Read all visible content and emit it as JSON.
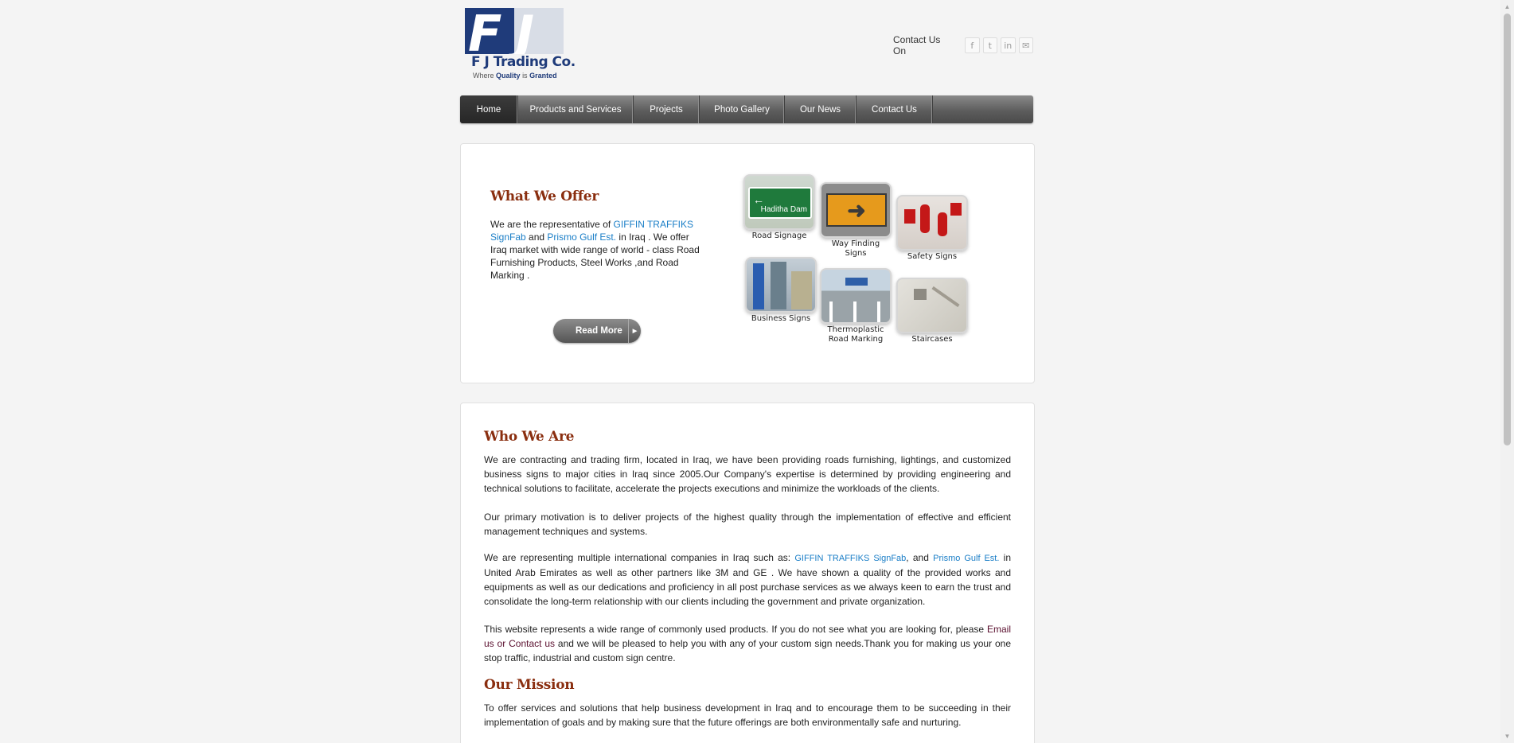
{
  "brand": {
    "name": "F J Trading Co.",
    "tagline_pre": "Where",
    "tagline_q": "Quality",
    "tagline_mid": "is",
    "tagline_g": "Granted",
    "color": "#1f3b7a"
  },
  "header": {
    "contact_label": "Contact Us On",
    "social": [
      "f",
      "t",
      "in",
      "✉"
    ]
  },
  "nav": {
    "items": [
      "Home",
      "Products and Services",
      "Projects",
      "Photo Gallery",
      "Our News",
      "Contact Us"
    ],
    "active": "Home"
  },
  "offer": {
    "title": "What We Offer",
    "text_1": "We are the representative of ",
    "link_giffin": "GIFFIN TRAFFIKS SignFab",
    "text_2": " and ",
    "link_prismo": "Prismo Gulf Est.",
    "text_3": " in Iraq . We offer Iraq market with wide range of world - class Road Furnishing Products, Steel Works ,and Road Marking .",
    "read_more": "Read More",
    "products": [
      "Road Signage",
      "Way Finding Signs",
      "Safety Signs",
      "Business Signs",
      "Thermoplastic Road Marking",
      "Staircases"
    ],
    "sign_text": "Haditha Dam"
  },
  "who": {
    "title": "Who We Are",
    "p1": "We are contracting and trading firm, located in Iraq, we have been providing roads furnishing, lightings, and customized business signs to major cities in Iraq since 2005.Our Company's expertise is determined by providing engineering and technical solutions to facilitate, accelerate the projects executions and minimize the workloads of the clients.",
    "p2": "Our primary motivation is to deliver projects of the highest quality through the implementation of effective and efficient management techniques and systems.",
    "p3_a": "We are representing multiple international companies in Iraq such as: ",
    "p3_link1": "GIFFIN TRAFFIKS SignFab",
    "p3_b": ", and ",
    "p3_link2": "Prismo Gulf Est.",
    "p3_c": "  in United Arab Emirates as well as other partners like 3M and GE . We have shown a quality of the provided works and equipments as well as our dedications and proficiency in all post purchase services as we always keen to earn the trust and consolidate the long-term relationship with our clients including the government and private organization.",
    "p4_a": "This website represents a wide range of commonly used products. If you do not see what you are looking for, please ",
    "p4_link1": "Email us",
    "p4_or": " or ",
    "p4_link2": "Contact us",
    "p4_b": " and we will be pleased to help you with any of your custom sign needs.Thank you for making us your one stop traffic, industrial and custom sign centre."
  },
  "mission": {
    "title": "Our Mission",
    "text": "To offer services and solutions that help business development in Iraq and to encourage them to be succeeding in their implementation of goals and by making sure that the future offerings are both environmentally safe and nurturing."
  }
}
